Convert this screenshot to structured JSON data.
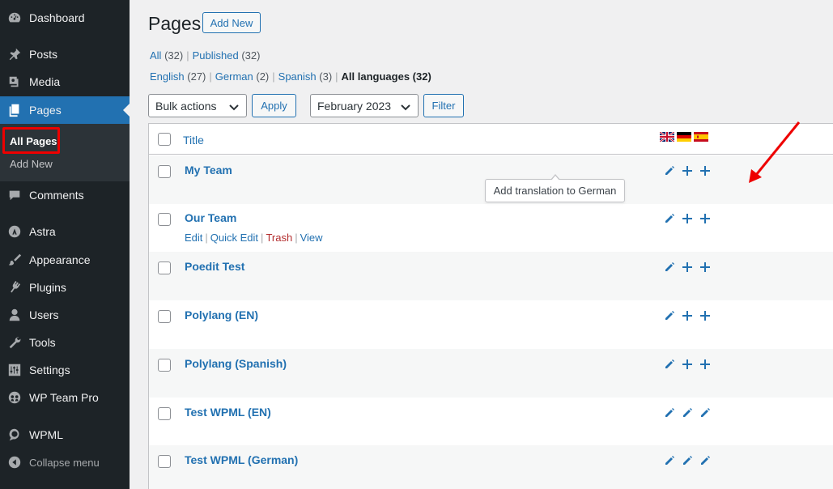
{
  "colors": {
    "sidebar_bg": "#1d2327",
    "accent": "#2271b1",
    "trash": "#b32d2e",
    "highlight_red": "#e00000"
  },
  "sidebar": {
    "items": [
      {
        "label": "Dashboard",
        "icon": "dashboard-icon"
      },
      {
        "label": "Posts",
        "icon": "pin-icon"
      },
      {
        "label": "Media",
        "icon": "media-icon"
      },
      {
        "label": "Pages",
        "icon": "pages-icon",
        "current": true
      },
      {
        "label": "Comments",
        "icon": "comment-icon"
      },
      {
        "label": "Astra",
        "icon": "astra-icon"
      },
      {
        "label": "Appearance",
        "icon": "brush-icon"
      },
      {
        "label": "Plugins",
        "icon": "plugin-icon"
      },
      {
        "label": "Users",
        "icon": "user-icon"
      },
      {
        "label": "Tools",
        "icon": "wrench-icon"
      },
      {
        "label": "Settings",
        "icon": "settings-icon"
      },
      {
        "label": "WP Team Pro",
        "icon": "team-icon"
      },
      {
        "label": "WPML",
        "icon": "wpml-icon"
      },
      {
        "label": "Collapse menu",
        "icon": "collapse-icon"
      }
    ],
    "submenu": [
      {
        "label": "All Pages",
        "active": true
      },
      {
        "label": "Add New"
      }
    ]
  },
  "header": {
    "title": "Pages",
    "add_new": "Add New"
  },
  "status_filter": {
    "all": "All",
    "all_count": "(32)",
    "published": "Published",
    "published_count": "(32)"
  },
  "lang_filter": {
    "english": "English",
    "english_count": "(27)",
    "german": "German",
    "german_count": "(2)",
    "spanish": "Spanish",
    "spanish_count": "(3)",
    "all": "All languages (32)"
  },
  "toolbar": {
    "bulk_actions": "Bulk actions",
    "apply": "Apply",
    "date": "February 2023",
    "filter": "Filter"
  },
  "table": {
    "title_header": "Title",
    "flags": [
      "uk-flag",
      "germany-flag",
      "spain-flag"
    ],
    "rows": [
      {
        "title": "My Team",
        "langs": [
          "edit",
          "add",
          "add"
        ]
      },
      {
        "title": "Our Team",
        "langs": [
          "edit",
          "add",
          "add"
        ],
        "actions": [
          "Edit",
          "Quick Edit",
          "Trash",
          "View"
        ]
      },
      {
        "title": "Poedit Test",
        "langs": [
          "edit",
          "add",
          "add"
        ]
      },
      {
        "title": "Polylang (EN)",
        "langs": [
          "edit",
          "add",
          "add"
        ]
      },
      {
        "title": "Polylang (Spanish)",
        "langs": [
          "edit",
          "add",
          "add"
        ]
      },
      {
        "title": "Test WPML (EN)",
        "langs": [
          "edit",
          "edit",
          "edit"
        ]
      },
      {
        "title": "Test WPML (German)",
        "langs": [
          "edit",
          "edit",
          "edit"
        ]
      }
    ]
  },
  "tooltip": "Add translation to German"
}
